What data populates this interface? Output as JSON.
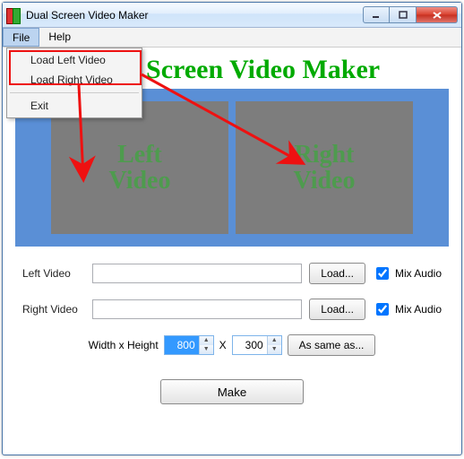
{
  "window": {
    "title": "Dual Screen Video Maker"
  },
  "menubar": {
    "file": "File",
    "help": "Help"
  },
  "dropdown": {
    "load_left": "Load Left Video",
    "load_right": "Load Right Video",
    "exit": "Exit"
  },
  "hero": {
    "title": "Dual Screen Video Maker",
    "left_slot_line1": "Left",
    "left_slot_line2": "Video",
    "right_slot_line1": "Right",
    "right_slot_line2": "Video"
  },
  "form": {
    "left_label": "Left Video",
    "right_label": "Right Video",
    "left_value": "",
    "right_value": "",
    "load_btn": "Load...",
    "mix_audio": "Mix Audio",
    "mix_left_checked": true,
    "mix_right_checked": true,
    "dims_label": "Width x Height",
    "width_value": "800",
    "height_value": "300",
    "times": "X",
    "as_same_btn": "As same as...",
    "make_btn": "Make"
  },
  "colors": {
    "accent_green": "#00aa00",
    "preview_bg": "#5a8fd6",
    "annotation_red": "#ee1111"
  }
}
